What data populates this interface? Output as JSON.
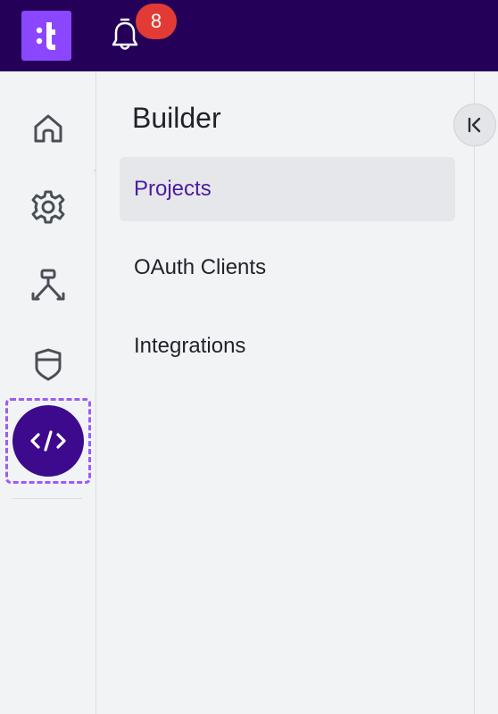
{
  "header": {
    "logo_icon": "teleport-logo-icon",
    "notifications_icon": "bell-icon",
    "notifications_count": "8",
    "brand_color": "#250058",
    "logo_color": "#8b46ff",
    "badge_color": "#e23b35"
  },
  "rail": {
    "items": [
      {
        "icon": "home-icon"
      },
      {
        "icon": "gear-icon"
      },
      {
        "icon": "workflow-icon"
      },
      {
        "icon": "shield-icon"
      },
      {
        "icon": "code-icon",
        "active": true
      }
    ],
    "active_color": "#3d0a8e"
  },
  "panel": {
    "title": "Builder",
    "items": [
      {
        "label": "Projects",
        "selected": true
      },
      {
        "label": "OAuth Clients"
      },
      {
        "label": "Integrations"
      }
    ],
    "selected_color": "#4b1ca0"
  },
  "collapse_button": {
    "icon": "collapse-left-icon"
  }
}
